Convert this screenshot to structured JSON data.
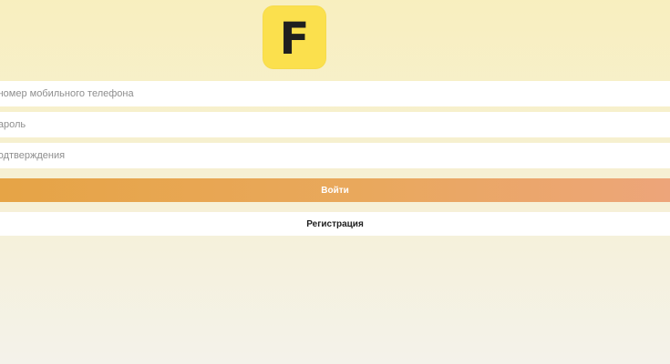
{
  "logo": {
    "letter": "F",
    "background_color": "#fbe04d"
  },
  "form": {
    "phone_placeholder": "Введите номер мобильного телефона",
    "password_placeholder": "Пароль",
    "code_placeholder": "Код подтверждения",
    "login_label": "Войти",
    "register_label": "Регистрация"
  },
  "colors": {
    "login_gradient_start": "#e6a446",
    "login_gradient_end": "#eda57a",
    "page_background": "#f8efbf"
  }
}
